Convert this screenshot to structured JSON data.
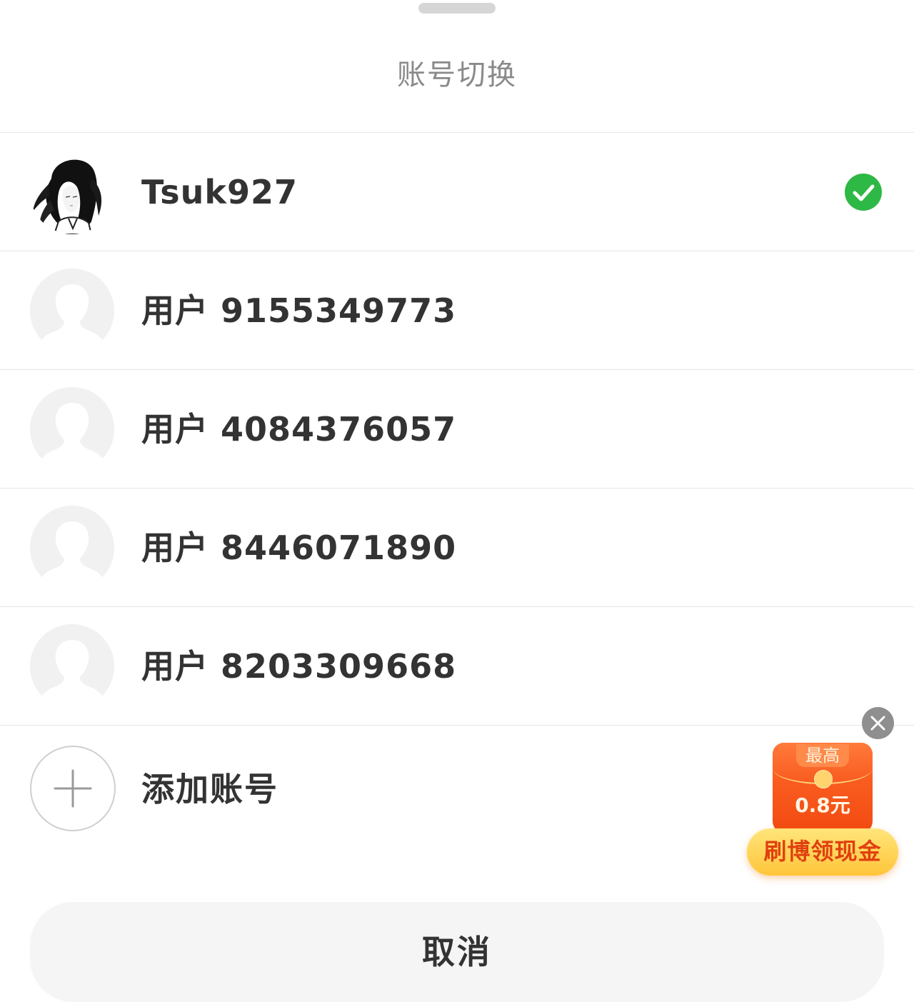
{
  "sheet": {
    "title": "账号切换"
  },
  "accounts": [
    {
      "name": "Tsuk927",
      "avatar": "anime-portrait",
      "selected": true
    },
    {
      "name": "用户 9155349773",
      "avatar": "default-avatar",
      "selected": false
    },
    {
      "name": "用户 4084376057",
      "avatar": "default-avatar",
      "selected": false
    },
    {
      "name": "用户 8446071890",
      "avatar": "default-avatar",
      "selected": false
    },
    {
      "name": "用户 8203309668",
      "avatar": "default-avatar",
      "selected": false
    }
  ],
  "add_account": {
    "label": "添加账号",
    "icon": "plus-icon"
  },
  "cancel": {
    "label": "取消"
  },
  "promo": {
    "badge": "最高",
    "amount": "0.8元",
    "cta": "刷博领现金",
    "close_icon": "close-icon"
  },
  "colors": {
    "selected_check": "#2eb845",
    "title_text": "#8a8a8a",
    "primary_text": "#333333",
    "divider": "#e6e6e6",
    "envelope": "#f24a12",
    "cta_text": "#e0400f"
  }
}
